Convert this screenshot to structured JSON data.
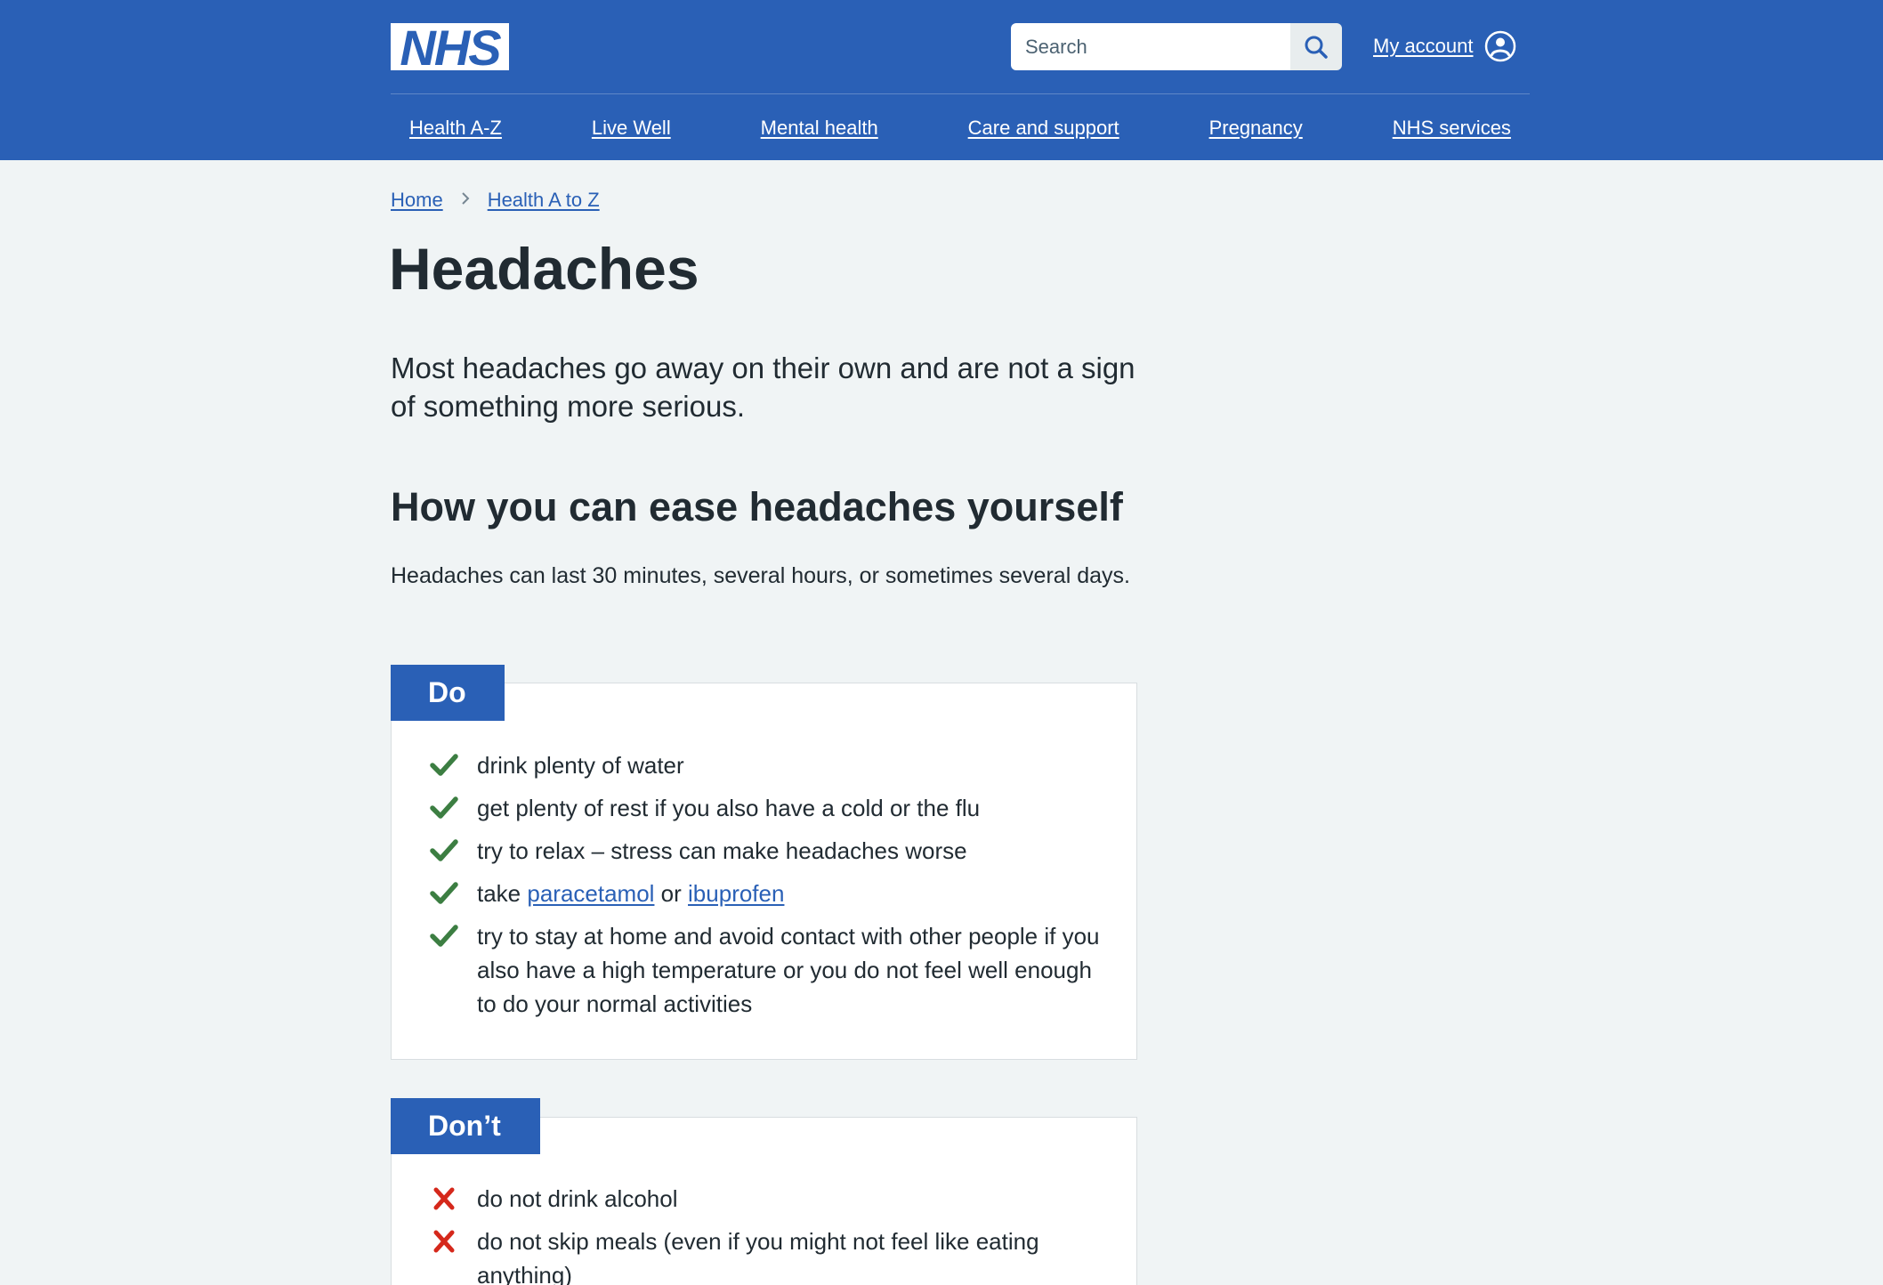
{
  "header": {
    "logo_text": "NHS",
    "search": {
      "placeholder": "Search"
    },
    "account_label": "My account",
    "nav": [
      "Health A-Z",
      "Live Well",
      "Mental health",
      "Care and support",
      "Pregnancy",
      "NHS services"
    ]
  },
  "breadcrumb": [
    "Home",
    "Health A to Z"
  ],
  "main": {
    "title": "Headaches",
    "lede": "Most headaches go away on their own and are not a sign of something more serious.",
    "section_heading": "How you can ease headaches yourself",
    "section_text": "Headaches can last 30 minutes, several hours, or sometimes several days.",
    "do": {
      "label": "Do",
      "items": [
        "drink plenty of water",
        "get plenty of rest if you also have a cold or the flu",
        "try to relax – stress can make headaches worse",
        {
          "before": "take ",
          "link1": "paracetamol",
          "middle": " or ",
          "link2": "ibuprofen"
        },
        "try to stay at home and avoid contact with other people if you also have a high temperature or you do not feel well enough to do your normal activities"
      ]
    },
    "dont": {
      "label": "Don’t",
      "items": [
        "do not drink alcohol",
        "do not skip meals (even if you might not feel like eating anything)"
      ]
    }
  },
  "colors": {
    "brand_blue": "#2a60b6",
    "tick_green": "#3c7e42",
    "cross_red": "#d5281b",
    "page_bg": "#f0f4f5",
    "text": "#212b32"
  },
  "icons": {
    "search": "search-icon",
    "account": "user-circle-icon",
    "breadcrumb_separator": "chevron-right-icon",
    "do_item": "tick-icon",
    "dont_item": "cross-icon"
  }
}
